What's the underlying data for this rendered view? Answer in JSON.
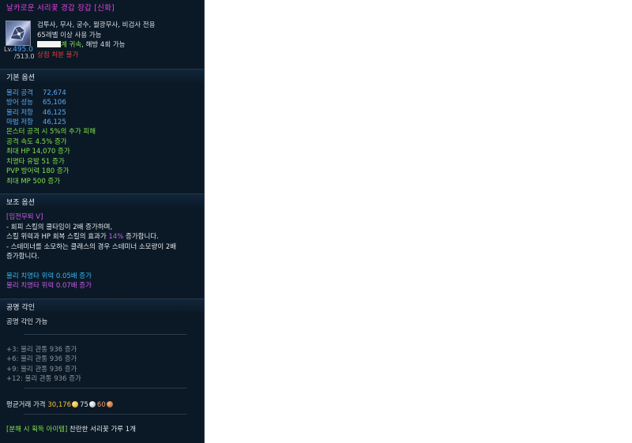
{
  "tooltip": {
    "title": "날카로운 서리꽃 경갑 장갑 [신화]",
    "icon": "gauntlet-icon",
    "level_prefix": "Lv.",
    "level_current": "495.0",
    "level_max": "/513.0",
    "classes": "검투사, 무사, 궁수, 월광무사, 비검사 전용",
    "level_req": "65레벨 이상 사용 가능",
    "bind_text": "계 귀속",
    "bind_extra": ", 해방 4회 가능",
    "trade_restriction": "상점 처분 불가"
  },
  "basic_options": {
    "header": "기본 옵션",
    "stats": [
      {
        "label": "물리 공격",
        "value": "72,674"
      },
      {
        "label": "방어 성능",
        "value": "65,106"
      },
      {
        "label": "물리 저항",
        "value": "46,125"
      },
      {
        "label": "마법 저항",
        "value": "46,125"
      }
    ],
    "bonuses": [
      "몬스터 공격 시 5%의 추가 피해",
      "공격 속도 4.5% 증가",
      "최대 HP 14,070 증가",
      "치명타 유발 51 증가",
      "PVP 방어력 180 증가",
      "최대 MP 500 증가"
    ]
  },
  "sub_options": {
    "header": "보조 옵션",
    "set_name": "[임전무퇴 V]",
    "line1": "- 회피 스킬의 쿨타임이 2배 증가하며,",
    "line2_pre": "스킬 위력과 HP 회복 스킬의 효과가 ",
    "line2_pct": "14%",
    "line2_post": " 증가합니다.",
    "line3": "- 스테미너를 소모하는 클래스의 경우 스테미너 소모량이 2배",
    "line4": "증가합니다.",
    "crit1": "물리 치명타 위력 0.05배 증가",
    "crit2": "물리 치명타 위력 0.07배 증가"
  },
  "resonance": {
    "header": "공명 각인",
    "status": "공명 각인 가능",
    "tiers": [
      "+3: 물리 관통 936 증가",
      "+6: 물리 관통 936 증가",
      "+9: 물리 관통 936 증가",
      "+12: 물리 관통 936 증가"
    ]
  },
  "price": {
    "label": "평균거래 가격",
    "gold": "30,176",
    "silver": "75",
    "copper": "60"
  },
  "disassembly": {
    "label": "[분해 시 획득 아이템]",
    "item": " 찬란한 서리꽃 가루 1개"
  },
  "colors": {
    "background": "#0b1926",
    "title": "#e040e0",
    "stat_blue": "#5aa9f5",
    "bonus_green": "#7ee24a",
    "warning_red": "#e23c3c",
    "purple": "#c55ce6",
    "cyan": "#34b9f3"
  }
}
